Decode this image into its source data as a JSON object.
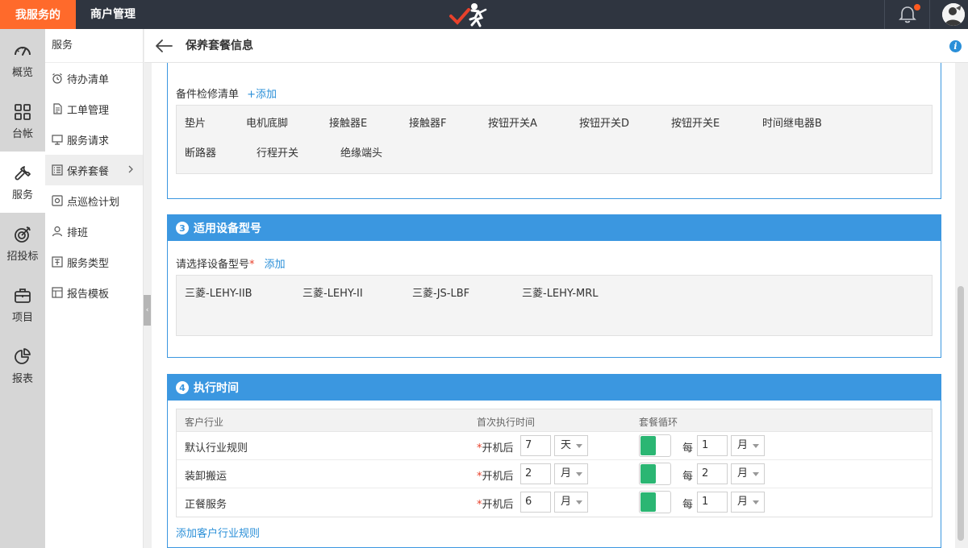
{
  "topbar": {
    "brand": "我服务的",
    "merchant": "商户管理"
  },
  "leftnav": [
    {
      "label": "概览",
      "icon": "gauge-icon"
    },
    {
      "label": "台帐",
      "icon": "grid-icon"
    },
    {
      "label": "服务",
      "icon": "wrench-icon",
      "active": true
    },
    {
      "label": "招投标",
      "icon": "target-icon"
    },
    {
      "label": "项目",
      "icon": "briefcase-icon"
    },
    {
      "label": "报表",
      "icon": "pie-chart-icon"
    }
  ],
  "subnav": {
    "title": "服务",
    "items": [
      {
        "label": "待办清单",
        "icon": "alarm-clock-icon"
      },
      {
        "label": "工单管理",
        "icon": "document-icon"
      },
      {
        "label": "服务请求",
        "icon": "monitor-icon"
      },
      {
        "label": "保养套餐",
        "icon": "list-icon",
        "active": true
      },
      {
        "label": "点巡检计划",
        "icon": "inspect-icon"
      },
      {
        "label": "排班",
        "icon": "person-icon"
      },
      {
        "label": "服务类型",
        "icon": "type-icon"
      },
      {
        "label": "报告模板",
        "icon": "template-icon"
      }
    ]
  },
  "header": {
    "title": "保养套餐信息"
  },
  "spare_parts": {
    "label": "备件检修清单",
    "add_label": "+添加",
    "items": [
      "垫片",
      "电机底脚",
      "接触器E",
      "接触器F",
      "按钮开关A",
      "按钮开关D",
      "按钮开关E",
      "时间继电器B",
      "断路器",
      "行程开关",
      "绝缘端头"
    ]
  },
  "section3": {
    "number": "3",
    "title": "适用设备型号",
    "field_label": "请选择设备型号",
    "required_mark": "*",
    "add_label": "添加",
    "models": [
      "三菱-LEHY-IIB",
      "三菱-LEHY-II",
      "三菱-JS-LBF",
      "三菱-LEHY-MRL"
    ]
  },
  "section4": {
    "number": "4",
    "title": "执行时间",
    "columns": [
      "客户行业",
      "首次执行时间",
      "套餐循环"
    ],
    "rows": [
      {
        "industry": "默认行业规则",
        "required_mark": "*",
        "first_label": "开机后",
        "first_value": "7",
        "first_unit": "天",
        "cycle_toggle_on": true,
        "every_label": "每",
        "cycle_value": "1",
        "cycle_unit": "月"
      },
      {
        "industry": "装卸搬运",
        "required_mark": "*",
        "first_label": "开机后",
        "first_value": "2",
        "first_unit": "月",
        "cycle_toggle_on": true,
        "every_label": "每",
        "cycle_value": "2",
        "cycle_unit": "月"
      },
      {
        "industry": "正餐服务",
        "required_mark": "*",
        "first_label": "开机后",
        "first_value": "6",
        "first_unit": "月",
        "cycle_toggle_on": true,
        "every_label": "每",
        "cycle_value": "1",
        "cycle_unit": "月"
      }
    ],
    "add_rule_label": "添加客户行业规则"
  },
  "colors": {
    "topbar": "#2f3540",
    "brand": "#ff6a2b",
    "accent": "#3b97e0",
    "link": "#2a8fd8",
    "toggle_on": "#2bb673",
    "required": "#e8412b"
  }
}
